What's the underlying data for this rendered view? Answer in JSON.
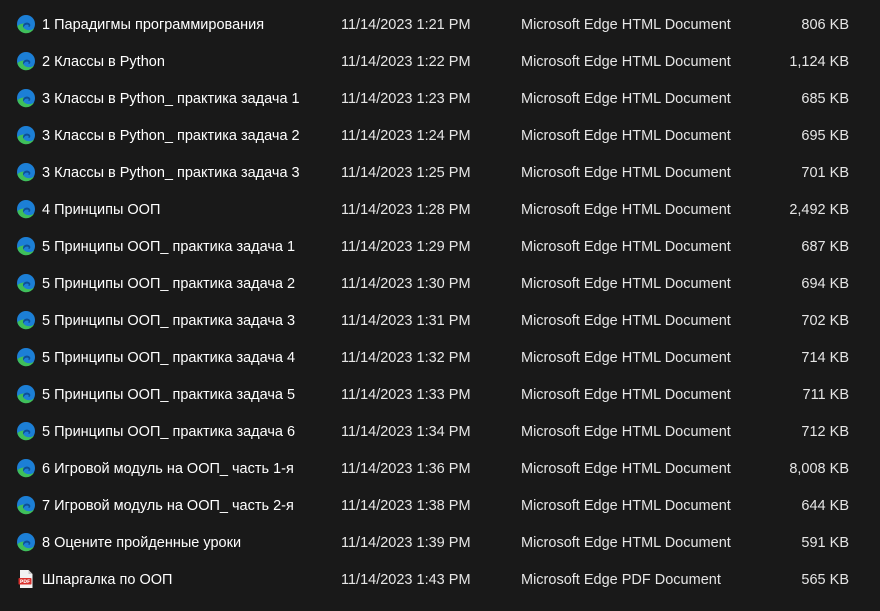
{
  "colors": {
    "background": "#191919",
    "text": "#ffffff",
    "edge_blue": "#1c7fd6",
    "edge_green": "#3fbf5a",
    "pdf_red": "#d9302c"
  },
  "files": [
    {
      "name": "1 Парадигмы программирования",
      "date": "11/14/2023 1:21 PM",
      "type": "Microsoft Edge HTML Document",
      "size": "806 KB",
      "icon": "edge-html-icon"
    },
    {
      "name": "2 Классы в Python",
      "date": "11/14/2023 1:22 PM",
      "type": "Microsoft Edge HTML Document",
      "size": "1,124 KB",
      "icon": "edge-html-icon"
    },
    {
      "name": "3 Классы в Python_ практика задача 1",
      "date": "11/14/2023 1:23 PM",
      "type": "Microsoft Edge HTML Document",
      "size": "685 KB",
      "icon": "edge-html-icon"
    },
    {
      "name": "3 Классы в Python_ практика задача 2",
      "date": "11/14/2023 1:24 PM",
      "type": "Microsoft Edge HTML Document",
      "size": "695 KB",
      "icon": "edge-html-icon"
    },
    {
      "name": "3 Классы в Python_ практика задача 3",
      "date": "11/14/2023 1:25 PM",
      "type": "Microsoft Edge HTML Document",
      "size": "701 KB",
      "icon": "edge-html-icon"
    },
    {
      "name": "4 Принципы ООП",
      "date": "11/14/2023 1:28 PM",
      "type": "Microsoft Edge HTML Document",
      "size": "2,492 KB",
      "icon": "edge-html-icon"
    },
    {
      "name": "5 Принципы ООП_ практика задача 1",
      "date": "11/14/2023 1:29 PM",
      "type": "Microsoft Edge HTML Document",
      "size": "687 KB",
      "icon": "edge-html-icon"
    },
    {
      "name": "5 Принципы ООП_ практика задача 2",
      "date": "11/14/2023 1:30 PM",
      "type": "Microsoft Edge HTML Document",
      "size": "694 KB",
      "icon": "edge-html-icon"
    },
    {
      "name": "5 Принципы ООП_ практика задача 3",
      "date": "11/14/2023 1:31 PM",
      "type": "Microsoft Edge HTML Document",
      "size": "702 KB",
      "icon": "edge-html-icon"
    },
    {
      "name": "5 Принципы ООП_ практика задача 4",
      "date": "11/14/2023 1:32 PM",
      "type": "Microsoft Edge HTML Document",
      "size": "714 KB",
      "icon": "edge-html-icon"
    },
    {
      "name": "5 Принципы ООП_ практика задача 5",
      "date": "11/14/2023 1:33 PM",
      "type": "Microsoft Edge HTML Document",
      "size": "711 KB",
      "icon": "edge-html-icon"
    },
    {
      "name": "5 Принципы ООП_ практика задача 6",
      "date": "11/14/2023 1:34 PM",
      "type": "Microsoft Edge HTML Document",
      "size": "712 KB",
      "icon": "edge-html-icon"
    },
    {
      "name": "6 Игровой модуль на ООП_ часть 1-я",
      "date": "11/14/2023 1:36 PM",
      "type": "Microsoft Edge HTML Document",
      "size": "8,008 KB",
      "icon": "edge-html-icon"
    },
    {
      "name": "7 Игровой модуль на ООП_ часть 2-я",
      "date": "11/14/2023 1:38 PM",
      "type": "Microsoft Edge HTML Document",
      "size": "644 KB",
      "icon": "edge-html-icon"
    },
    {
      "name": "8 Оцените пройденные уроки",
      "date": "11/14/2023 1:39 PM",
      "type": "Microsoft Edge HTML Document",
      "size": "591 KB",
      "icon": "edge-html-icon"
    },
    {
      "name": "Шпаргалка по ООП",
      "date": "11/14/2023 1:43 PM",
      "type": "Microsoft Edge PDF Document",
      "size": "565 KB",
      "icon": "pdf-file-icon"
    }
  ]
}
